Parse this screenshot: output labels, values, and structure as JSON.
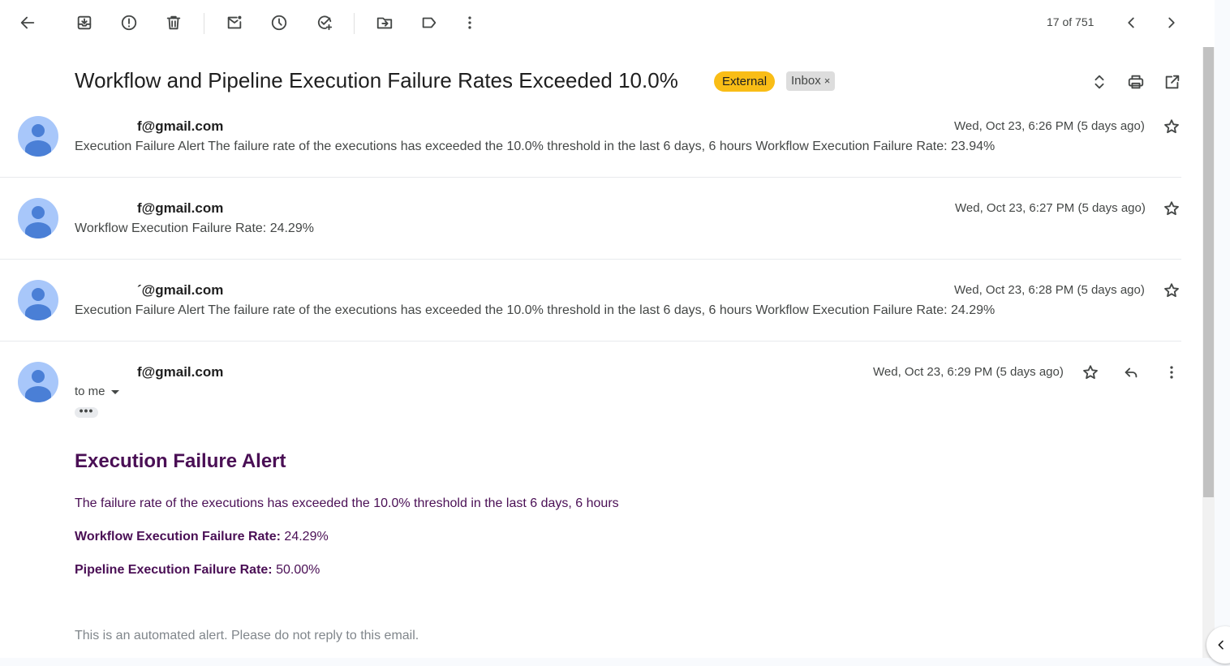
{
  "toolbar": {
    "counter": "17 of 751"
  },
  "thread": {
    "subject": "Workflow and Pipeline Execution Failure Rates Exceeded 10.0%",
    "labels": {
      "external": "External",
      "inbox": "Inbox",
      "inbox_remove": "×"
    }
  },
  "messages": [
    {
      "sender": "f@gmail.com",
      "date": "Wed, Oct 23, 6:26 PM (5 days ago)",
      "snippet": "Execution Failure Alert The failure rate of the executions has exceeded the 10.0% threshold in the last 6 days, 6 hours Workflow Execution Failure Rate: 23.94%"
    },
    {
      "sender": "f@gmail.com",
      "date": "Wed, Oct 23, 6:27 PM (5 days ago)",
      "snippet": "Workflow Execution Failure Rate: 24.29%"
    },
    {
      "sender": "´@gmail.com",
      "date": "Wed, Oct 23, 6:28 PM (5 days ago)",
      "snippet": "Execution Failure Alert The failure rate of the executions has exceeded the 10.0% threshold in the last 6 days, 6 hours Workflow Execution Failure Rate: 24.29%"
    }
  ],
  "open_message": {
    "sender": "f@gmail.com",
    "date": "Wed, Oct 23, 6:29 PM (5 days ago)",
    "to": "to me",
    "dots": "•••",
    "body": {
      "title": "Execution Failure Alert",
      "text": "The failure rate of the executions has exceeded the 10.0% threshold in the last 6 days, 6 hours",
      "workflow_label": "Workflow Execution Failure Rate:",
      "workflow_value": "24.29%",
      "pipeline_label": "Pipeline Execution Failure Rate:",
      "pipeline_value": "50.00%",
      "footer": "This is an automated alert. Please do not reply to this email."
    }
  },
  "colors": {
    "external_tag": "#f9bd16",
    "avatar_bg": "#a8c7fa",
    "avatar_fg": "#4a7fd6",
    "alert_text": "#4a0f55"
  }
}
